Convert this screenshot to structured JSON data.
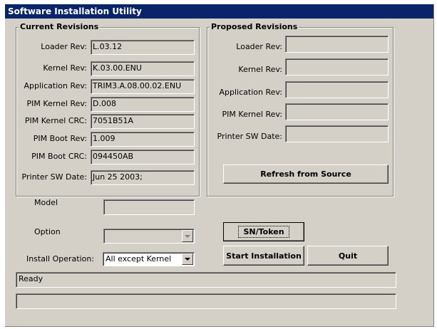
{
  "window": {
    "title": "Software Installation Utility"
  },
  "current": {
    "title": "Current Revisions",
    "rows": [
      {
        "label": "Loader Rev:",
        "value": "L.03.12"
      },
      {
        "label": "Kernel Rev:",
        "value": "K.03.00.ENU"
      },
      {
        "label": "Application Rev:",
        "value": "TRIM3.A.08.00.02.ENU"
      },
      {
        "label": "PIM Kernel Rev:",
        "value": "D.008"
      },
      {
        "label": "PIM Kernel CRC:",
        "value": "7051B51A"
      },
      {
        "label": "PIM Boot Rev:",
        "value": "1.009"
      },
      {
        "label": "PIM Boot CRC:",
        "value": "094450AB"
      },
      {
        "label": "Printer SW Date:",
        "value": "Jun 25 2003;"
      }
    ]
  },
  "proposed": {
    "title": "Proposed Revisions",
    "rows": [
      {
        "label": "Loader Rev:",
        "value": ""
      },
      {
        "label": "Kernel Rev:",
        "value": ""
      },
      {
        "label": "Application Rev:",
        "value": ""
      },
      {
        "label": "PIM Kernel Rev:",
        "value": ""
      },
      {
        "label": "Printer SW Date:",
        "value": ""
      }
    ],
    "refresh_label": "Refresh from Source"
  },
  "model": {
    "label": "Model",
    "value": ""
  },
  "option": {
    "label": "Option",
    "value": ""
  },
  "install": {
    "label": "Install Operation:",
    "value": "All except Kernel"
  },
  "buttons": {
    "sn_token": "SN/Token",
    "start": "Start Installation",
    "quit": "Quit"
  },
  "status": {
    "message": "Ready",
    "detail": ""
  },
  "icons": {
    "dropdown": "chevron-down-icon"
  }
}
